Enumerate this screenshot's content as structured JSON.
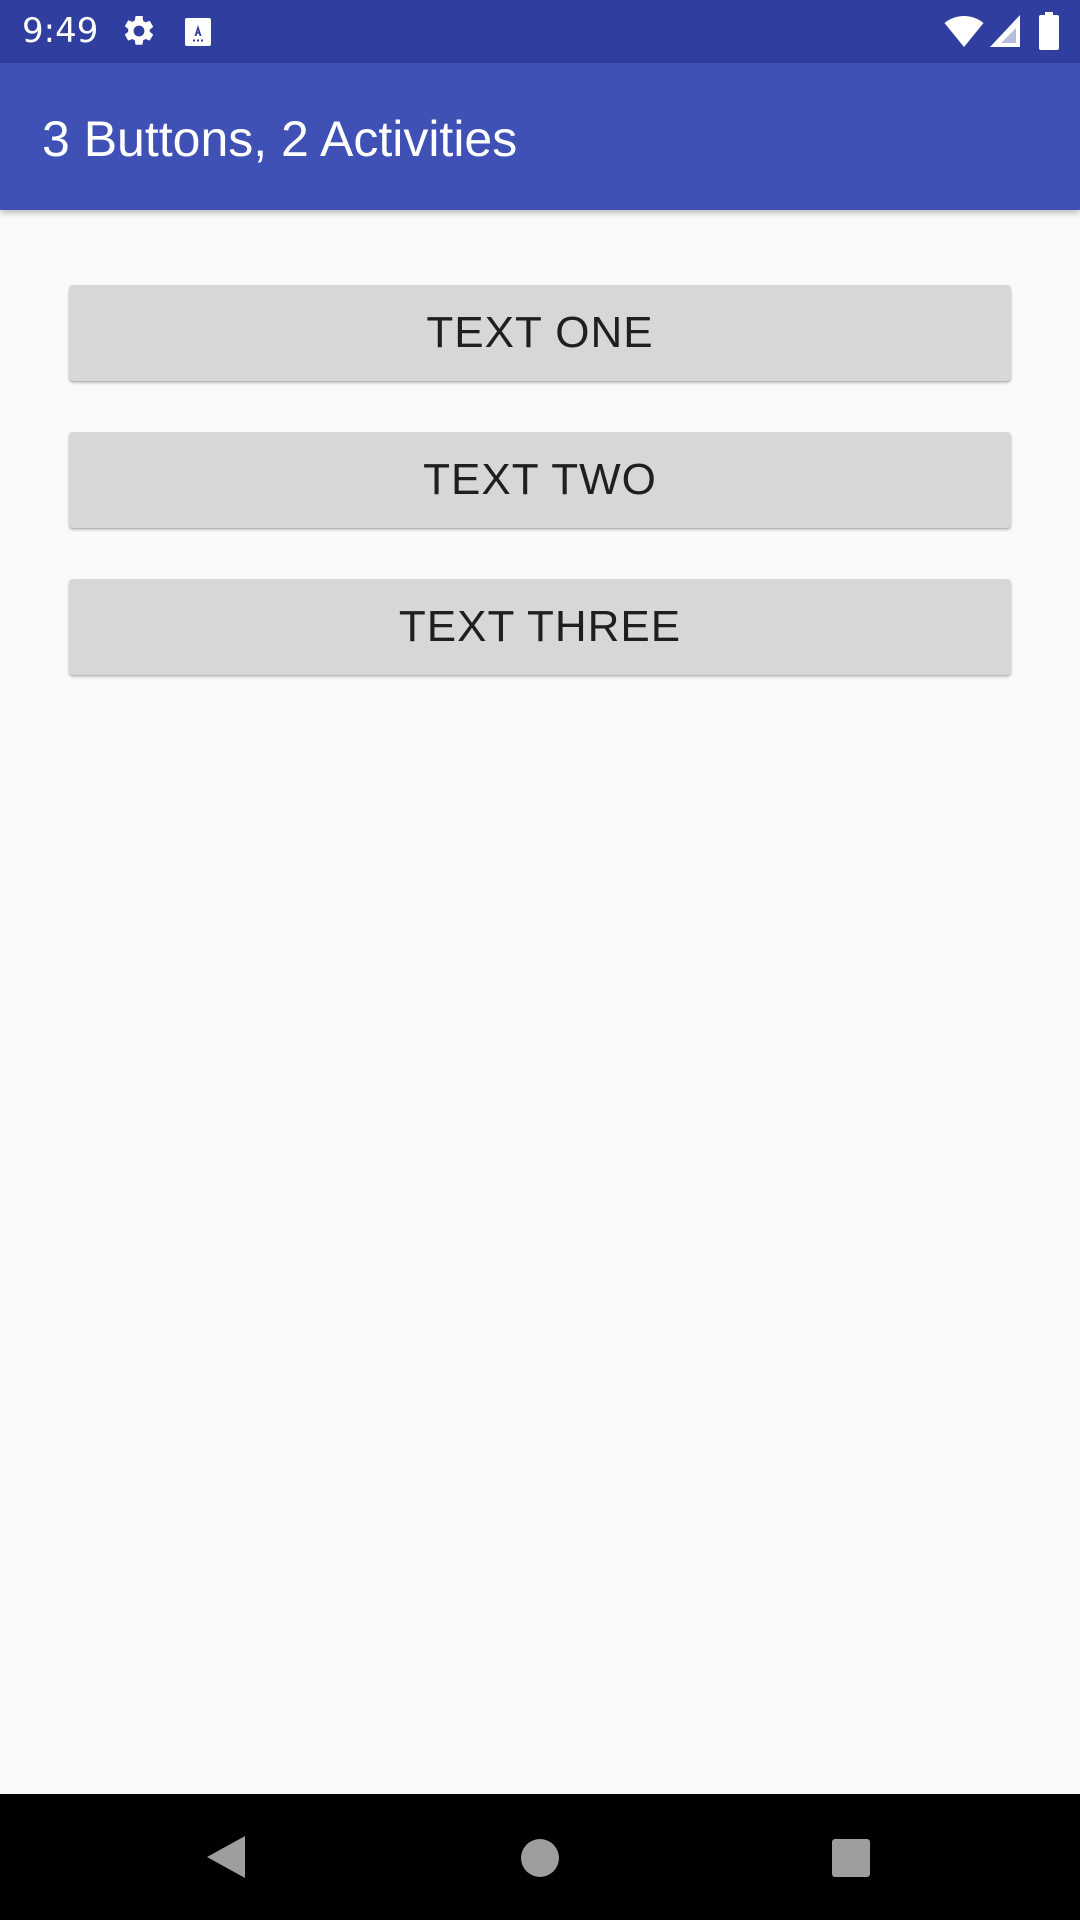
{
  "status_bar": {
    "time": "9:49",
    "icons": [
      "gear-icon",
      "keyboard-a-icon",
      "wifi-icon",
      "signal-icon",
      "battery-icon"
    ],
    "background_color": "#303f9f"
  },
  "app_bar": {
    "title": "3 Buttons, 2 Activities",
    "background_color": "#3f51b5"
  },
  "buttons": [
    {
      "label": "TEXT ONE"
    },
    {
      "label": "TEXT TWO"
    },
    {
      "label": "TEXT THREE"
    }
  ],
  "nav_bar": {
    "icons": [
      "back-icon",
      "home-icon",
      "recents-icon"
    ]
  }
}
